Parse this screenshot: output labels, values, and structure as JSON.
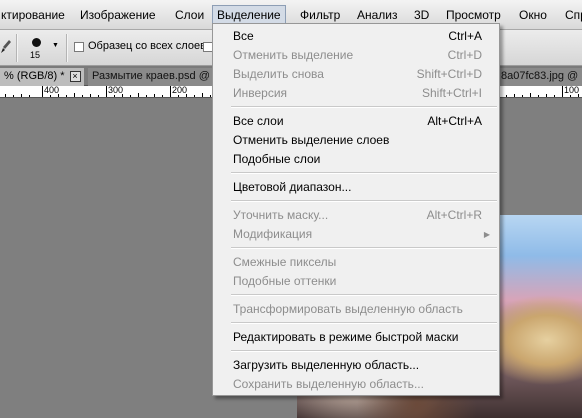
{
  "menubar": {
    "items": [
      {
        "label": "ктирование"
      },
      {
        "label": "Изображение"
      },
      {
        "label": "Слои"
      },
      {
        "label": "Выделение"
      },
      {
        "label": "Фильтр"
      },
      {
        "label": "Анализ"
      },
      {
        "label": "3D"
      },
      {
        "label": "Просмотр"
      },
      {
        "label": "Окно"
      },
      {
        "label": "Спр"
      }
    ]
  },
  "options": {
    "brush_size": "15",
    "sample_all_layers_label": "Образец со всех слоев"
  },
  "tabs": [
    {
      "label": "% (RGB/8) *"
    },
    {
      "label": "Размытие краев.psd @"
    },
    {
      "label": "8a07fc83.jpg @"
    }
  ],
  "ruler": {
    "labels": [
      "400",
      "300",
      "200",
      "100"
    ]
  },
  "select_menu": {
    "items": [
      {
        "label": "Все",
        "shortcut": "Ctrl+A",
        "disabled": false
      },
      {
        "label": "Отменить выделение",
        "shortcut": "Ctrl+D",
        "disabled": true
      },
      {
        "label": "Выделить снова",
        "shortcut": "Shift+Ctrl+D",
        "disabled": true
      },
      {
        "label": "Инверсия",
        "shortcut": "Shift+Ctrl+I",
        "disabled": true
      },
      {
        "label": "Все слои",
        "shortcut": "Alt+Ctrl+A",
        "disabled": false
      },
      {
        "label": "Отменить выделение слоев",
        "shortcut": "",
        "disabled": false
      },
      {
        "label": "Подобные слои",
        "shortcut": "",
        "disabled": false
      },
      {
        "label": "Цветовой диапазон...",
        "shortcut": "",
        "disabled": false
      },
      {
        "label": "Уточнить маску...",
        "shortcut": "Alt+Ctrl+R",
        "disabled": true
      },
      {
        "label": "Модификация",
        "shortcut": "",
        "disabled": true,
        "submenu": true
      },
      {
        "label": "Смежные пикселы",
        "shortcut": "",
        "disabled": true
      },
      {
        "label": "Подобные оттенки",
        "shortcut": "",
        "disabled": true
      },
      {
        "label": "Трансформировать выделенную область",
        "shortcut": "",
        "disabled": true
      },
      {
        "label": "Редактировать в режиме быстрой маски",
        "shortcut": "",
        "disabled": false
      },
      {
        "label": "Загрузить выделенную область...",
        "shortcut": "",
        "disabled": false
      },
      {
        "label": "Сохранить выделенную область...",
        "shortcut": "",
        "disabled": true
      }
    ]
  },
  "colors": {
    "menu_bg": "#f0f0f0",
    "disabled_text": "#8d8d8d",
    "active_menu_highlight": "#d3dbe6"
  }
}
